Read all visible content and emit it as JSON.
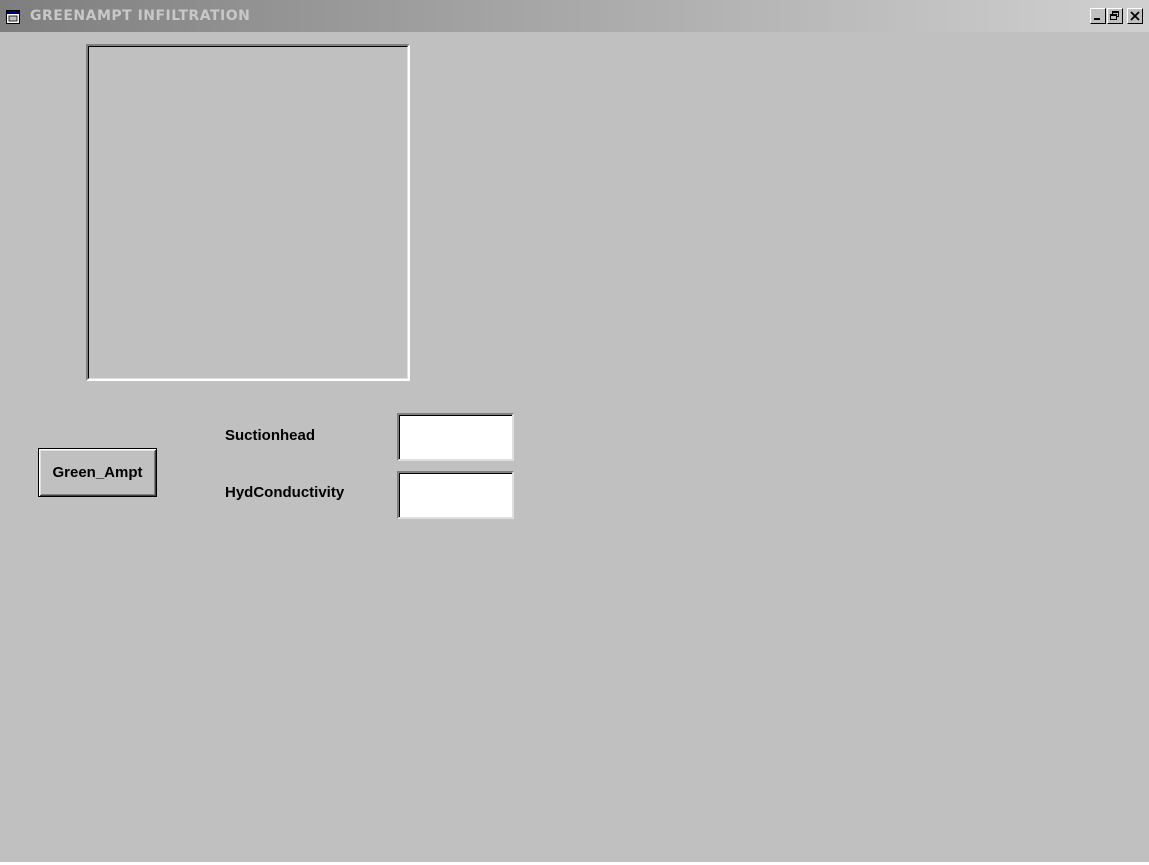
{
  "window": {
    "title": "GREENAMPT INFILTRATION",
    "app_icon": "form-window-icon",
    "controls": [
      "minimize-icon",
      "restore-icon",
      "close-icon"
    ]
  },
  "form": {
    "button_label": "Green_Ampt",
    "suction_label": "Suctionhead",
    "suction_value": "",
    "hyd_label": "HydConductivity",
    "hyd_value": ""
  },
  "colors": {
    "form_background": "#c0c0c0",
    "input_background": "#ffffff"
  }
}
